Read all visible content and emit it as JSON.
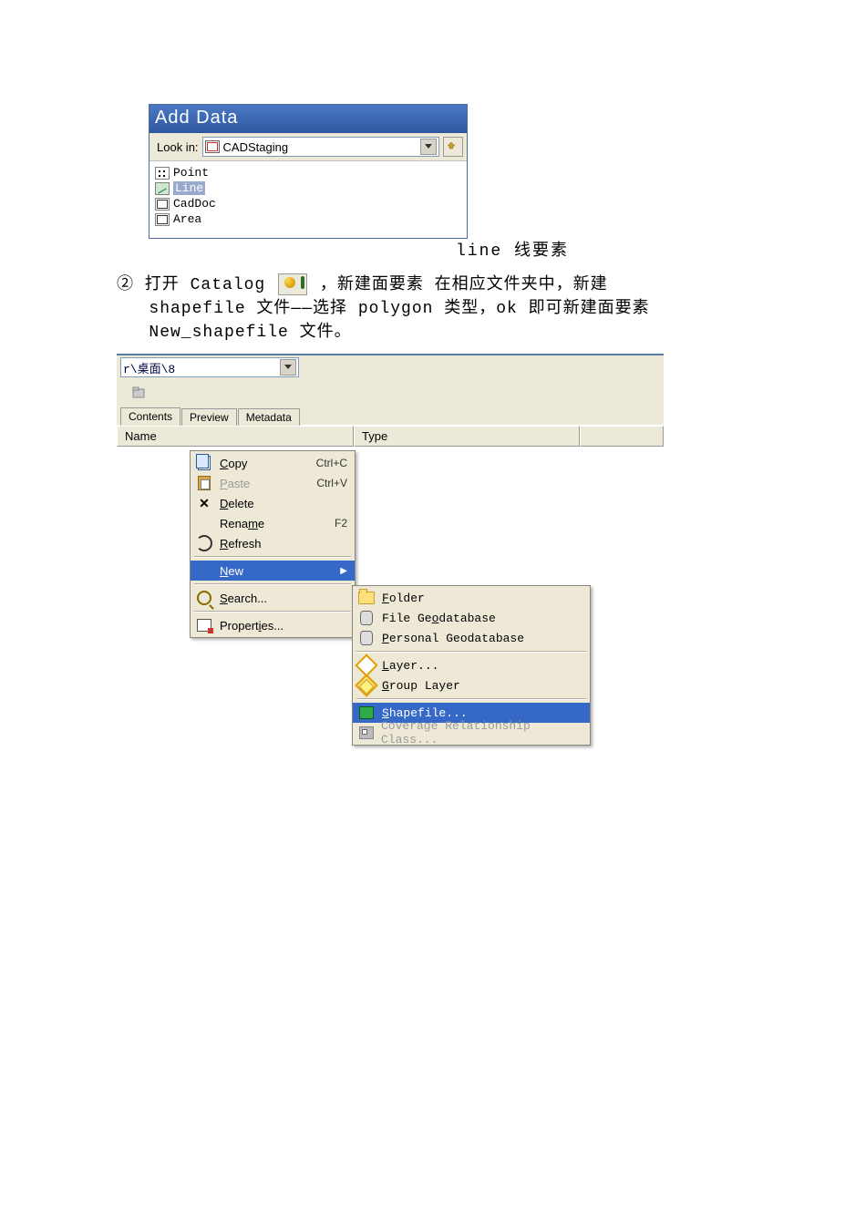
{
  "annot1": "line 线要素",
  "para2_line1_a": "② 打开 Catalog",
  "para2_line1_b": "，新建面要素   在相应文件夹中，新建",
  "para2_line2": "shapefile 文件——选择 polygon 类型，ok 即可新建面要素",
  "para2_line3": "New_shapefile 文件。",
  "addData": {
    "title": "Add Data",
    "lookin_label": "Look in:",
    "lookin_value": "CADStaging",
    "items": [
      {
        "name": "Point",
        "icon": "point",
        "selected": false
      },
      {
        "name": "Line",
        "icon": "line",
        "selected": true
      },
      {
        "name": "CadDoc",
        "icon": "cad",
        "selected": false
      },
      {
        "name": "Area",
        "icon": "cad",
        "selected": false
      }
    ]
  },
  "catalog": {
    "path": "r\\桌面\\8",
    "tabs": [
      "Contents",
      "Preview",
      "Metadata"
    ],
    "active_tab": "Contents",
    "headers": {
      "name": "Name",
      "type": "Type"
    },
    "ctx": {
      "copy": {
        "label": "Copy",
        "u": "C",
        "sc": "Ctrl+C"
      },
      "paste": {
        "label": "Paste",
        "u": "P",
        "sc": "Ctrl+V",
        "disabled": true
      },
      "delete": {
        "label": "Delete",
        "u": "D"
      },
      "rename": {
        "label": "Rename",
        "u": "m",
        "sc": "F2"
      },
      "refresh": {
        "label": "Refresh",
        "u": "R"
      },
      "new": {
        "label": "New",
        "u": "N",
        "selected": true,
        "submenu": true
      },
      "search": {
        "label": "Search...",
        "u": "S"
      },
      "props": {
        "label": "Properties...",
        "u": "i"
      }
    },
    "submenu": {
      "folder": {
        "label": "Folder",
        "u": "F"
      },
      "fgdb": {
        "label": "File Geodatabase",
        "u": "o"
      },
      "pgdb": {
        "label": "Personal Geodatabase",
        "u": "P"
      },
      "layer": {
        "label": "Layer...",
        "u": "L"
      },
      "glayer": {
        "label": "Group Layer",
        "u": "G"
      },
      "shp": {
        "label": "Shapefile...",
        "u": "S",
        "selected": true
      },
      "covrel": {
        "label": "Coverage Relationship Class...",
        "disabled": true
      }
    }
  }
}
